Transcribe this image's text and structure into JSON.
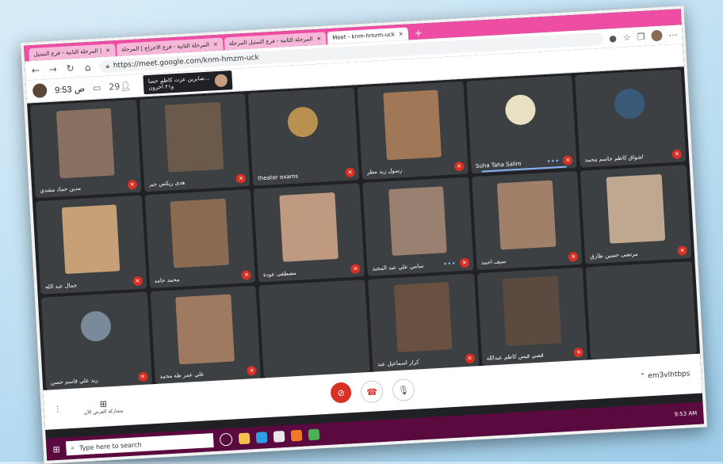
{
  "browser": {
    "tabs": [
      {
        "label": "المرحلة الثانية - فرع التمثيل | ",
        "active": false
      },
      {
        "label": "المرحلة الثانية - فرع الاخراج | المرحلة",
        "active": false
      },
      {
        "label": "المرحلة الثانية - فرع التمثيل المرحلة",
        "active": false
      },
      {
        "label": "Meet - knm-hmzm-uck",
        "active": true
      }
    ],
    "new_tab": "+",
    "url": "https://meet.google.com/knm-hmzm-uck"
  },
  "meet_top": {
    "time": "9:53",
    "period": "ص",
    "chat_count": "29",
    "presenter_name": "صابرين عزت كاظم حسا...",
    "presenter_sub": "و٢١ آخرون"
  },
  "participants": [
    {
      "name": "مدين حماد مشدي",
      "kind": "video",
      "color": "#8a7060"
    },
    {
      "name": "هدى ريكس جبر",
      "kind": "video",
      "color": "#6b5a4a"
    },
    {
      "name": "theater exams",
      "kind": "avatar",
      "color": "#b89050"
    },
    {
      "name": "رسول زيد مطر",
      "kind": "video",
      "color": "#a07858"
    },
    {
      "name": "Suha Taha Salim",
      "kind": "avatar",
      "color": "#e8e0c0",
      "speaking": true
    },
    {
      "name": "اشواق كاظم جاسم محمد",
      "kind": "avatar",
      "color": "#3a5a7a"
    },
    {
      "name": "جمال عبد الله",
      "kind": "video",
      "color": "#c8a078"
    },
    {
      "name": "محمد حامد",
      "kind": "video",
      "color": "#8a6a50"
    },
    {
      "name": "مصطفى عودة",
      "kind": "video",
      "color": "#c09a80"
    },
    {
      "name": "سامي علي عبد المجيد",
      "kind": "video",
      "color": "#9a8070",
      "dots": true
    },
    {
      "name": "سيف احمد",
      "kind": "video",
      "color": "#a08068"
    },
    {
      "name": "مرتضى حسين طارق",
      "kind": "video",
      "color": "#c0a890"
    },
    {
      "name": "زيد علي قاسم حسن",
      "kind": "avatar",
      "color": "#7a8a9a"
    },
    {
      "name": "علي عمر طه محمد",
      "kind": "video",
      "color": "#a07a60"
    },
    {
      "name": "",
      "kind": "empty",
      "color": "#3c4043"
    },
    {
      "name": "كرار اسماعيل عبد",
      "kind": "video",
      "color": "#6a5040"
    },
    {
      "name": "قصي قيس كاظم عبدالله",
      "kind": "video",
      "color": "#5a4a40"
    },
    {
      "name": "",
      "kind": "empty",
      "color": "#3c4043"
    }
  ],
  "controls": {
    "present_label": "مشاركة العرض الآن",
    "meeting_code": "em3vlhtbps"
  },
  "taskbar": {
    "search_placeholder": "Type here to search",
    "time": "9:53 AM"
  }
}
